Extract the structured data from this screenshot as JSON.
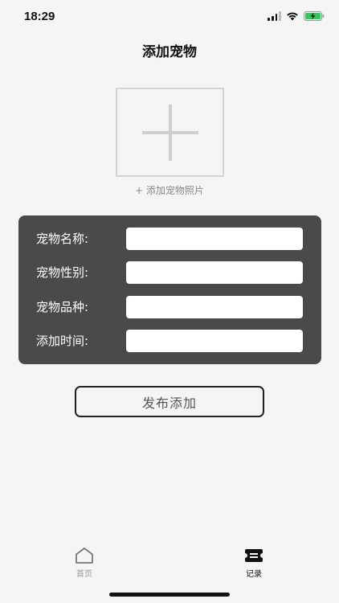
{
  "status_bar": {
    "time": "18:29",
    "icons": [
      "signal-icon",
      "wifi-icon",
      "battery-charging-icon"
    ],
    "battery_color": "#34c759"
  },
  "header": {
    "title": "添加宠物"
  },
  "photo": {
    "icon": "plus-icon",
    "add_label": "+ 添加宠物照片"
  },
  "form": {
    "panel_color": "#4a4a4a",
    "fields": [
      {
        "label": "宠物名称:",
        "value": "",
        "placeholder": ""
      },
      {
        "label": "宠物性别:",
        "value": "",
        "placeholder": ""
      },
      {
        "label": "宠物品种:",
        "value": "",
        "placeholder": ""
      },
      {
        "label": "添加时间:",
        "value": "",
        "placeholder": ""
      }
    ]
  },
  "submit": {
    "label": "发布添加"
  },
  "tab_bar": {
    "tabs": [
      {
        "label": "首页",
        "icon": "home-icon",
        "active": false
      },
      {
        "label": "记录",
        "icon": "ticket-icon",
        "active": true
      }
    ]
  }
}
